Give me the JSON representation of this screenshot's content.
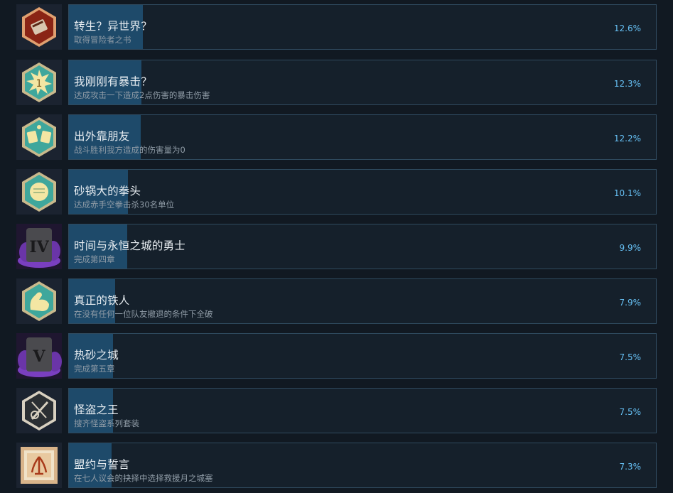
{
  "achievements": [
    {
      "title": "转生？异世界？",
      "desc": "取得冒险者之书",
      "percent": "12.6%",
      "rate": 12.6,
      "icon": "book-badge-icon"
    },
    {
      "title": "我刚刚有暴击？",
      "desc": "达成攻击一下造成2点伤害的暴击伤害",
      "percent": "12.3%",
      "rate": 12.3,
      "icon": "critical-hit-badge-icon"
    },
    {
      "title": "出外靠朋友",
      "desc": "战斗胜利我方造成的伤害量为0",
      "percent": "12.2%",
      "rate": 12.2,
      "icon": "cheers-mugs-badge-icon"
    },
    {
      "title": "砂锅大的拳头",
      "desc": "达成赤手空拳击杀30名单位",
      "percent": "10.1%",
      "rate": 10.1,
      "icon": "fist-badge-icon"
    },
    {
      "title": "时间与永恒之城的勇士",
      "desc": "完成第四章",
      "percent": "9.9%",
      "rate": 9.9,
      "icon": "chapter-four-tombstone-icon"
    },
    {
      "title": "真正的铁人",
      "desc": "在没有任何一位队友撤退的条件下全破",
      "percent": "7.9%",
      "rate": 7.9,
      "icon": "flexed-arm-badge-icon"
    },
    {
      "title": "热砂之城",
      "desc": "完成第五章",
      "percent": "7.5%",
      "rate": 7.5,
      "icon": "chapter-five-tombstone-icon"
    },
    {
      "title": "怪盗之王",
      "desc": "搜齐怪盗系列套装",
      "percent": "7.5%",
      "rate": 7.5,
      "icon": "thief-tools-badge-icon"
    },
    {
      "title": "盟约与誓言",
      "desc": "在七人议会的抉择中选择救援月之城塞",
      "percent": "7.3%",
      "rate": 7.3,
      "icon": "covenant-scroll-icon"
    }
  ]
}
